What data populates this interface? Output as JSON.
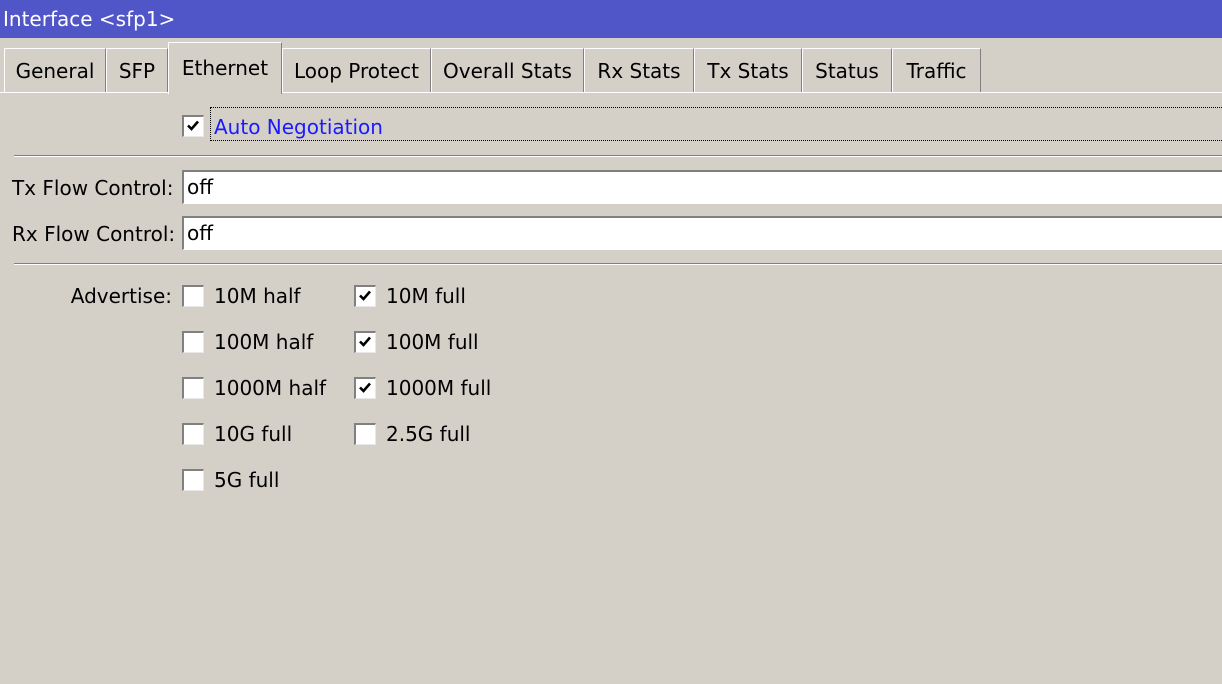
{
  "window": {
    "title": "Interface <sfp1>"
  },
  "tabs": [
    {
      "label": "General"
    },
    {
      "label": "SFP"
    },
    {
      "label": "Ethernet",
      "active": true
    },
    {
      "label": "Loop Protect"
    },
    {
      "label": "Overall Stats"
    },
    {
      "label": "Rx Stats"
    },
    {
      "label": "Tx Stats"
    },
    {
      "label": "Status"
    },
    {
      "label": "Traffic"
    }
  ],
  "ethernet": {
    "auto_negotiation": {
      "label": "Auto Negotiation",
      "checked": true
    },
    "tx_flow_control": {
      "label": "Tx Flow Control:",
      "value": "off"
    },
    "rx_flow_control": {
      "label": "Rx Flow Control:",
      "value": "off"
    },
    "advertise": {
      "label": "Advertise:",
      "options": [
        {
          "label": "10M half",
          "checked": false
        },
        {
          "label": "10M full",
          "checked": true
        },
        {
          "label": "100M half",
          "checked": false
        },
        {
          "label": "100M full",
          "checked": true
        },
        {
          "label": "1000M half",
          "checked": false
        },
        {
          "label": "1000M full",
          "checked": true
        },
        {
          "label": "10G full",
          "checked": false
        },
        {
          "label": "2.5G full",
          "checked": false
        },
        {
          "label": "5G full",
          "checked": false
        }
      ]
    }
  },
  "colors": {
    "titlebar": "#5055c8",
    "window_bg": "#d4d0c8",
    "auto_negotiation_text": "#1a1aff"
  }
}
